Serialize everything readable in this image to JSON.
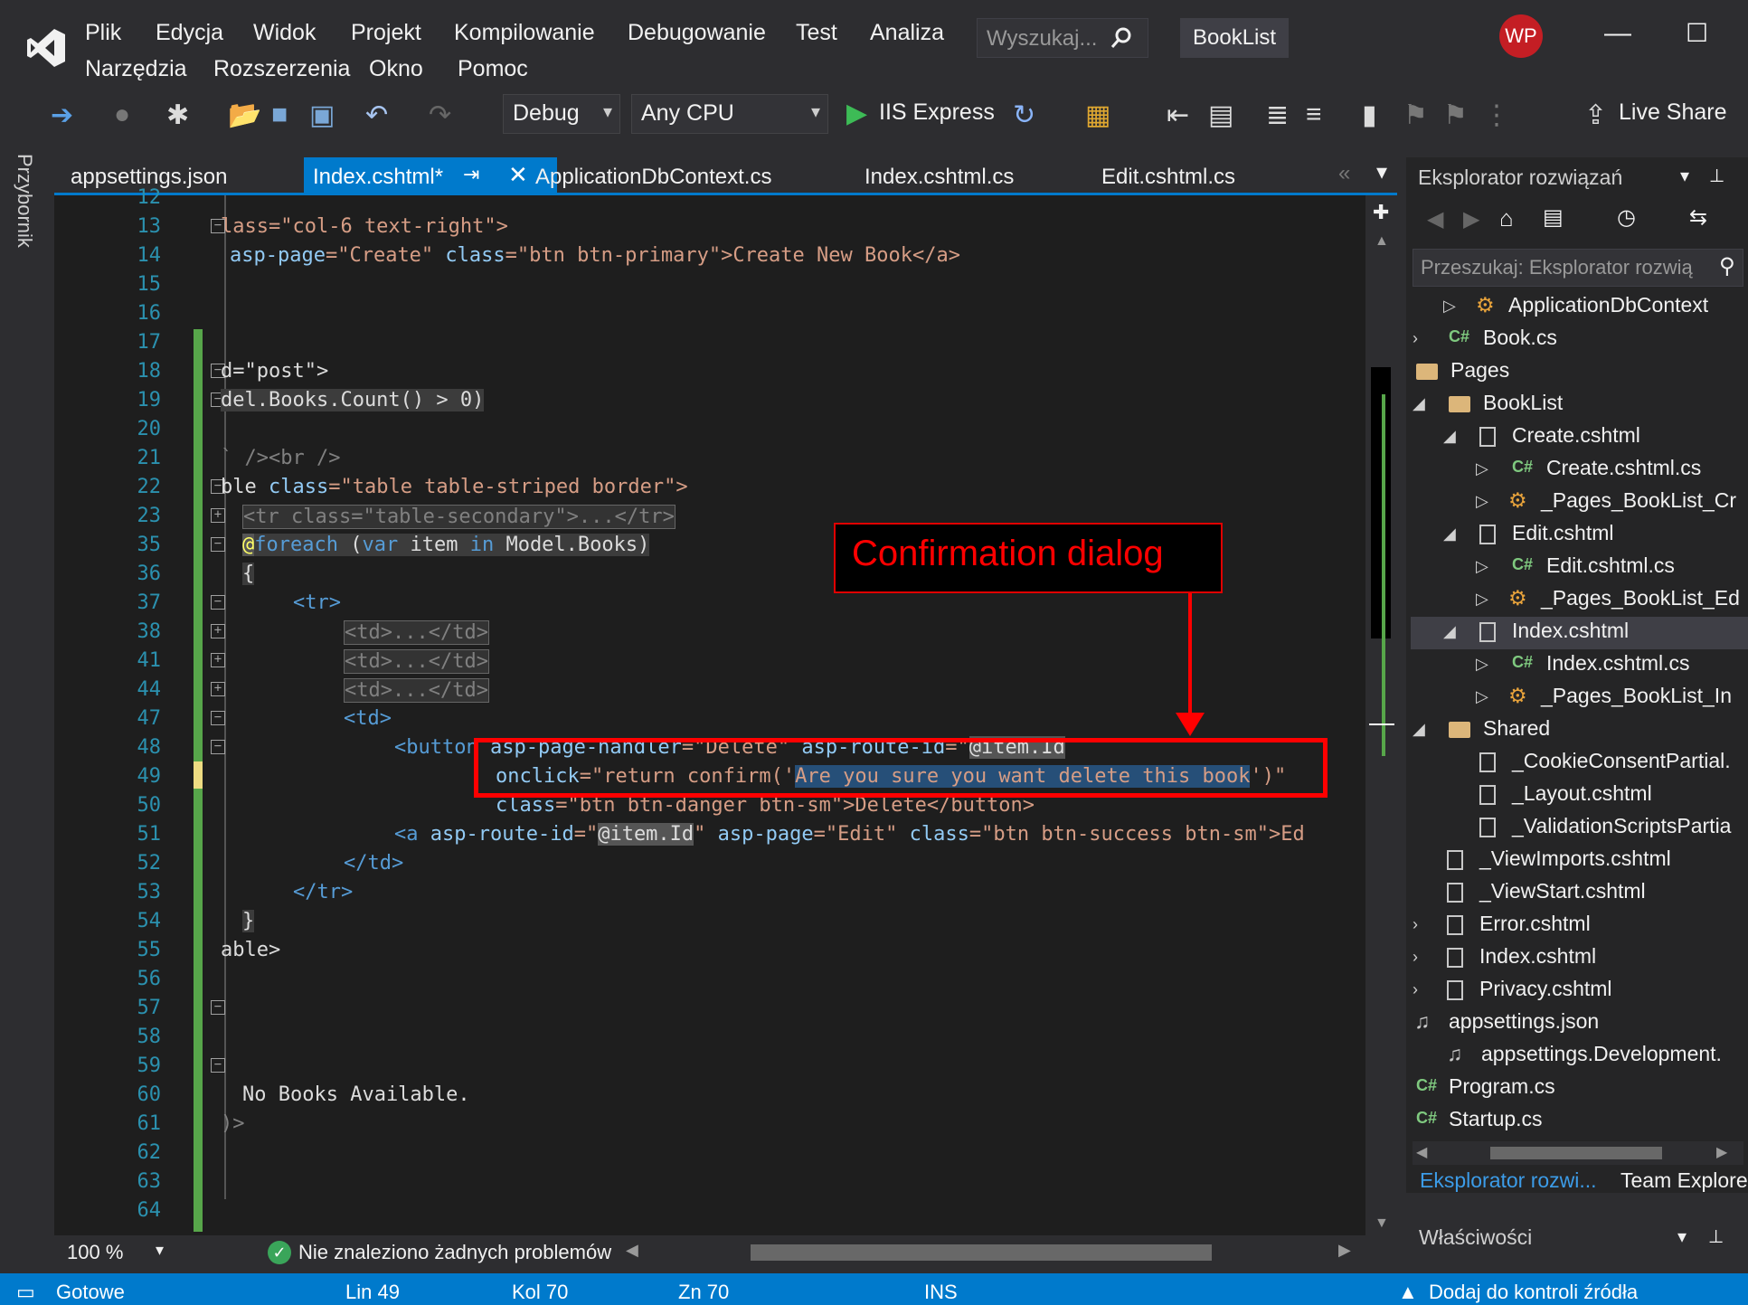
{
  "menu": {
    "row1": [
      "Plik",
      "Edycja",
      "Widok",
      "Projekt",
      "Kompilowanie",
      "Debugowanie",
      "Test",
      "Analiza"
    ],
    "row2": [
      "Narzędzia",
      "Rozszerzenia",
      "Okno",
      "Pomoc"
    ],
    "search_placeholder": "Wyszukaj...",
    "solution_name": "BookList",
    "user_initials": "WP"
  },
  "toolbar": {
    "configuration": "Debug",
    "platform": "Any CPU",
    "run_target": "IIS Express",
    "live_share": "Live Share"
  },
  "toolbox_label": "Przybornik",
  "tabs": [
    {
      "label": "appsettings.json"
    },
    {
      "label": "Index.cshtml*",
      "active": true
    },
    {
      "label": "ApplicationDbContext.cs"
    },
    {
      "label": "Index.cshtml.cs"
    },
    {
      "label": "Edit.cshtml.cs"
    }
  ],
  "editor": {
    "line_numbers": [
      "12",
      "13",
      "14",
      "15",
      "16",
      "17",
      "18",
      "19",
      "20",
      "21",
      "22",
      "23",
      "35",
      "36",
      "37",
      "38",
      "41",
      "44",
      "47",
      "48",
      "49",
      "50",
      "51",
      "52",
      "53",
      "54",
      "55",
      "56",
      "57",
      "58",
      "59",
      "60",
      "61",
      "62",
      "63",
      "64"
    ],
    "lines": {
      "l13": "lass=\"col-6 text-right\">",
      "l14a": "asp-page",
      "l14b": "=\"Create\" ",
      "l14c": "class",
      "l14d": "=\"btn btn-primary\">Create New Book</a>",
      "l18": "d=\"post\">",
      "l19": "del.Books.Count() > 0)",
      "l21": "` /><br />",
      "l22a": "ble ",
      "l22b": "class",
      "l22c": "=\"table table-striped border\">",
      "l23": "<tr class=\"table-secondary\">...</tr>",
      "l35a": "@",
      "l35b": "foreach",
      "l35c": " (",
      "l35d": "var",
      "l35e": " item ",
      "l35f": "in",
      "l35g": " Model.Books)",
      "l36": "{",
      "l37": "<tr>",
      "l38": "<td>...</td>",
      "l41": "<td>...</td>",
      "l44": "<td>...</td>",
      "l47": "<td>",
      "l48a": "<button ",
      "l48b": "asp-page-handler",
      "l48c": "=\"Delete\" ",
      "l48d": "asp-route-id",
      "l48e": "=\"",
      "l48f": "@item.Id",
      "l49a": "onclick",
      "l49b": "=\"return confirm('",
      "l49c": "Are you sure you want delete this book",
      "l49d": "')\"",
      "l50a": "class",
      "l50b": "=\"btn btn-danger btn-sm\">Delete</button>",
      "l51a": "<a ",
      "l51b": "asp-route-id",
      "l51c": "=\"",
      "l51d": "@item.Id",
      "l51e": "\" ",
      "l51f": "asp-page",
      "l51g": "=\"Edit\" ",
      "l51h": "class",
      "l51i": "=\"btn btn-success btn-sm\">Ed",
      "l52": "</td>",
      "l53": "</tr>",
      "l54": "}",
      "l55": "able>",
      "l60": "No Books Available.",
      "l61": ")>"
    }
  },
  "annotation": {
    "label": "Confirmation dialog",
    "color": "#ff0000"
  },
  "solution_explorer": {
    "title": "Eksplorator rozwiązań",
    "search_placeholder": "Przeszukaj: Eksplorator rozwią",
    "items": [
      {
        "label": "ApplicationDbContext",
        "icon": "class-icon"
      },
      {
        "label": "Book.cs",
        "icon": "csharp-file-icon"
      },
      {
        "label": "Pages",
        "icon": "folder-icon"
      },
      {
        "label": "BookList",
        "icon": "folder-icon"
      },
      {
        "label": "Create.cshtml",
        "icon": "razor-file-icon"
      },
      {
        "label": "Create.cshtml.cs",
        "icon": "csharp-file-icon"
      },
      {
        "label": "_Pages_BookList_Cr",
        "icon": "class-icon"
      },
      {
        "label": "Edit.cshtml",
        "icon": "razor-file-icon"
      },
      {
        "label": "Edit.cshtml.cs",
        "icon": "csharp-file-icon"
      },
      {
        "label": "_Pages_BookList_Ed",
        "icon": "class-icon"
      },
      {
        "label": "Index.cshtml",
        "icon": "razor-file-icon",
        "selected": true
      },
      {
        "label": "Index.cshtml.cs",
        "icon": "csharp-file-icon"
      },
      {
        "label": "_Pages_BookList_In",
        "icon": "class-icon"
      },
      {
        "label": "Shared",
        "icon": "folder-icon"
      },
      {
        "label": "_CookieConsentPartial.",
        "icon": "razor-file-icon"
      },
      {
        "label": "_Layout.cshtml",
        "icon": "razor-file-icon"
      },
      {
        "label": "_ValidationScriptsPartia",
        "icon": "razor-file-icon"
      },
      {
        "label": "_ViewImports.cshtml",
        "icon": "razor-file-icon"
      },
      {
        "label": "_ViewStart.cshtml",
        "icon": "razor-file-icon"
      },
      {
        "label": "Error.cshtml",
        "icon": "razor-file-icon"
      },
      {
        "label": "Index.cshtml",
        "icon": "razor-file-icon"
      },
      {
        "label": "Privacy.cshtml",
        "icon": "razor-file-icon"
      },
      {
        "label": "appsettings.json",
        "icon": "json-file-icon"
      },
      {
        "label": "appsettings.Development.",
        "icon": "json-file-icon"
      },
      {
        "label": "Program.cs",
        "icon": "csharp-file-icon"
      },
      {
        "label": "Startup.cs",
        "icon": "csharp-file-icon"
      }
    ],
    "bottom_tabs": [
      "Eksplorator rozwi...",
      "Team Explore"
    ],
    "properties_title": "Właściwości"
  },
  "editor_status": {
    "zoom": "100 %",
    "problems": "Nie znaleziono żadnych problemów"
  },
  "statusbar": {
    "ready": "Gotowe",
    "line": "Lin 49",
    "col": "Kol 70",
    "char": "Zn 70",
    "mode": "INS",
    "source_control": "Dodaj do kontroli źródła"
  }
}
